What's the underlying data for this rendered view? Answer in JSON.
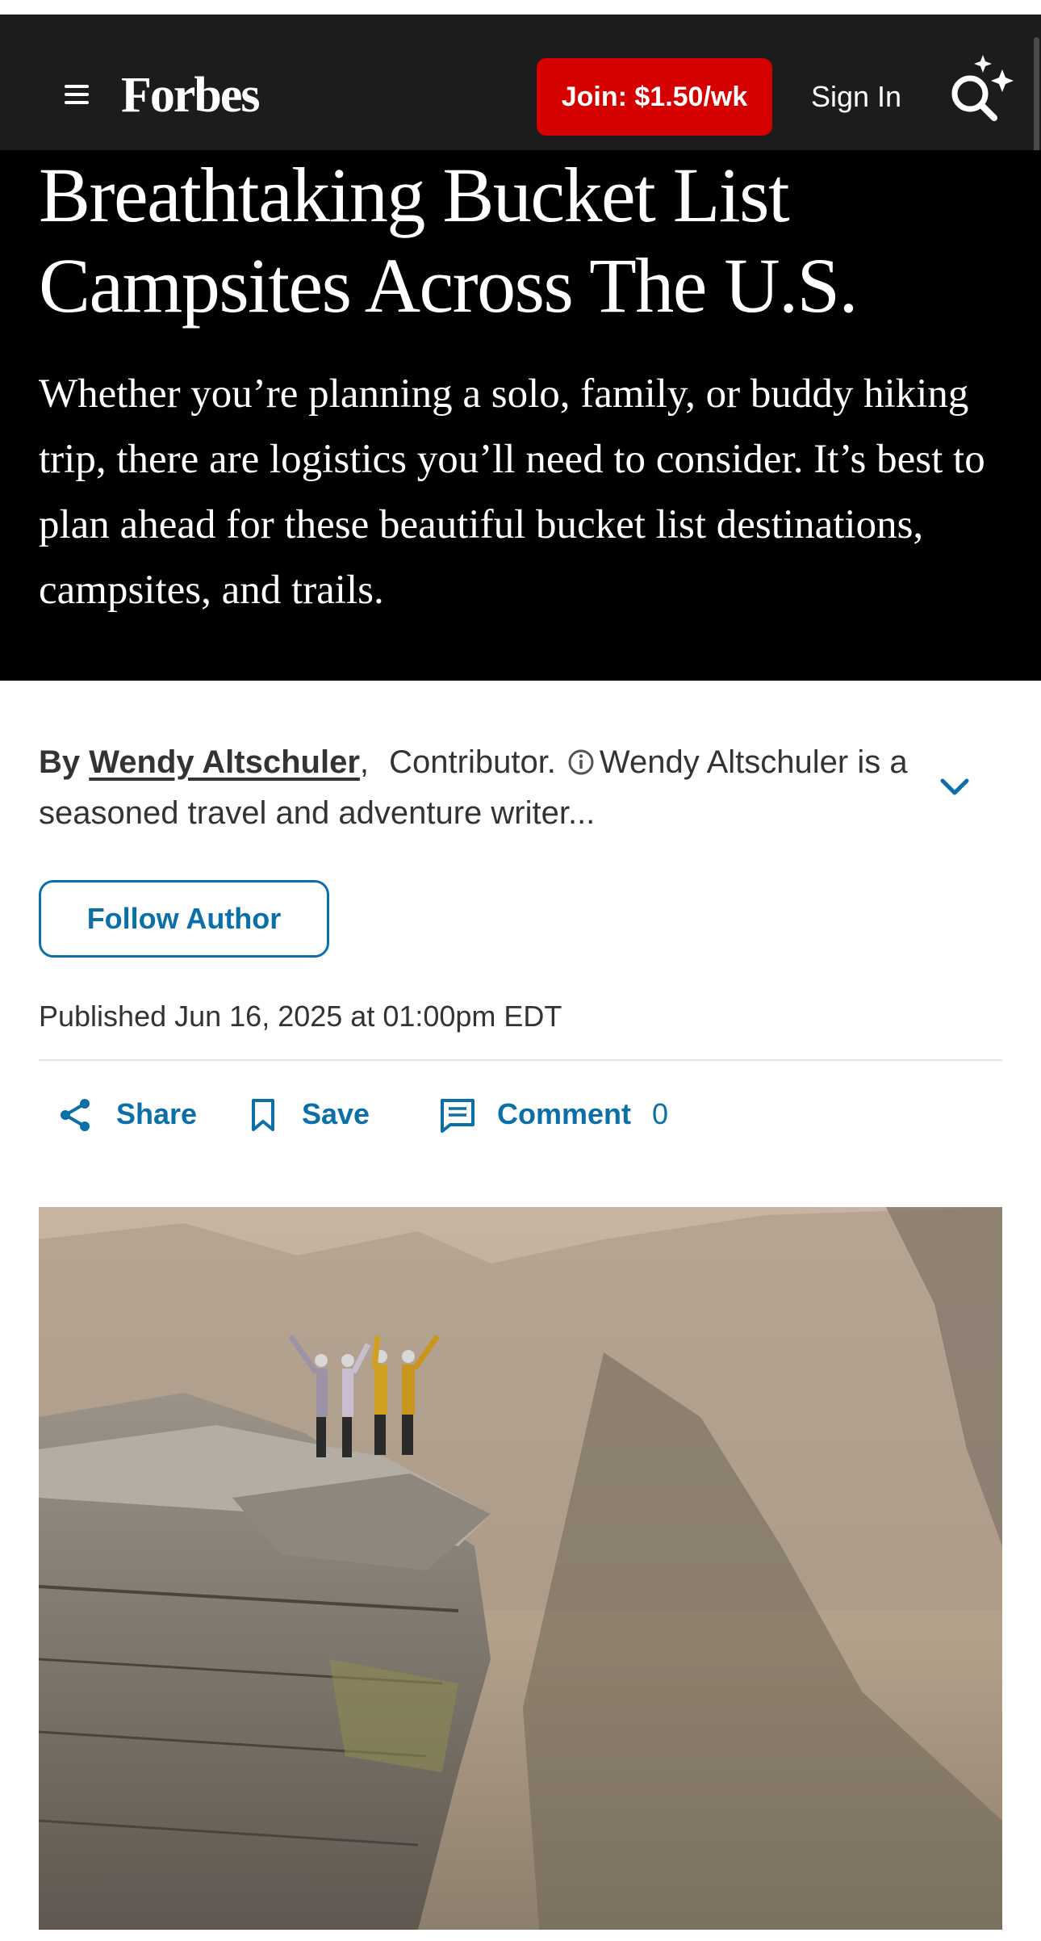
{
  "header": {
    "menu_icon": "hamburger-menu-icon",
    "logo_text": "Forbes",
    "join_label": "Join: $1.50/wk",
    "signin_label": "Sign In",
    "search_icon": "ai-search-sparkle-icon"
  },
  "article": {
    "headline": "Breathtaking Bucket List Campsites Across The U.S.",
    "dek": "Whether you’re planning a solo, family, or buddy hiking trip, there are logistics you’ll need to consider. It’s best to plan ahead for these beautiful bucket list destinations, campsites, and trails.",
    "byline_prefix": "By",
    "author": "Wendy Altschuler",
    "comma": ",",
    "role": "Contributor.",
    "bio_preview": "Wendy Altschuler is a seasoned travel and adventure writer...",
    "follow_label": "Follow Author",
    "published": "Published Jun 16, 2025 at 01:00pm EDT"
  },
  "actions": {
    "share_label": "Share",
    "save_label": "Save",
    "comment_label": "Comment",
    "comment_count": "0"
  },
  "colors": {
    "nav_bg": "#1c1c1c",
    "hero_bg": "#000000",
    "join_red": "#d50000",
    "link_blue": "#0b6fa9"
  }
}
